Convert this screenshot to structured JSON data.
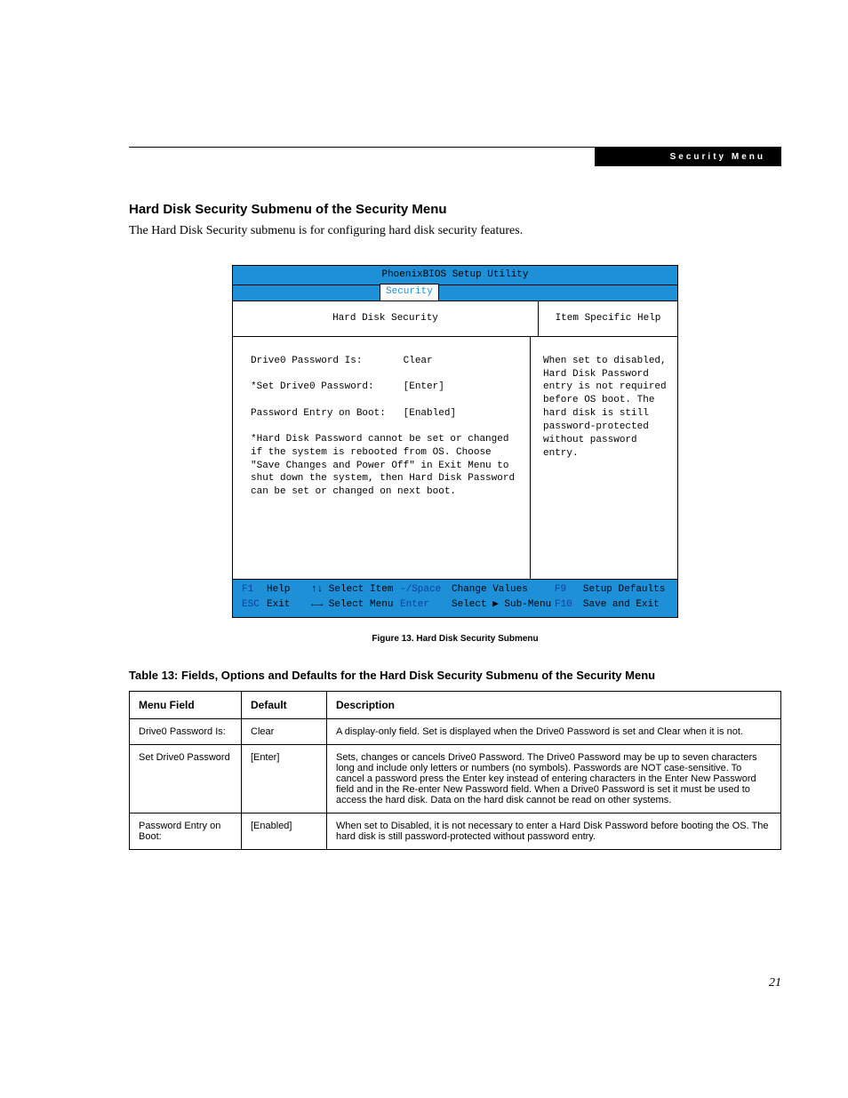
{
  "header": {
    "breadcrumb": "Security Menu"
  },
  "section": {
    "heading": "Hard Disk Security Submenu of the Security Menu",
    "sub": "The Hard Disk Security submenu is for configuring hard disk security features."
  },
  "bios": {
    "title": "PhoenixBIOS Setup Utility",
    "tab": "Security",
    "panel_heading_left": "Hard Disk Security",
    "panel_heading_right": "Item Specific Help",
    "fields": [
      {
        "label": "Drive0 Password Is:",
        "value": "Clear"
      },
      {
        "label": "*Set Drive0 Password:",
        "value": "[Enter]"
      },
      {
        "label": "Password Entry on Boot:",
        "value": "[Enabled]"
      }
    ],
    "note": "*Hard Disk Password cannot be set or changed if the system is rebooted from OS. Choose \"Save Changes and Power Off\" in Exit Menu to shut down the system, then Hard Disk Password can be set or changed on next boot.",
    "help_text": "When set to disabled, Hard Disk Password entry is not required before OS boot. The hard disk is still password-protected without password entry.",
    "footer": {
      "r1": {
        "k1": "F1",
        "l1": "Help",
        "nav1": "↑↓ Select Item",
        "k2": "-/Space",
        "l2": "Change Values",
        "k3": "F9",
        "l3": "Setup Defaults"
      },
      "r2": {
        "k1": "ESC",
        "l1": "Exit",
        "nav1": "←→ Select Menu",
        "k2": "Enter",
        "l2": "Select ▶ Sub-Menu",
        "k3": "F10",
        "l3": "Save and Exit"
      }
    }
  },
  "figure_caption": "Figure 13.   Hard Disk Security Submenu",
  "table_caption": "Table 13: Fields, Options and Defaults for the Hard Disk Security Submenu of the Security Menu",
  "table": {
    "headers": [
      "Menu Field",
      "Default",
      "Description"
    ],
    "rows": [
      {
        "field": "Drive0 Password Is:",
        "default": "Clear",
        "desc": "A display-only field. Set is displayed when the Drive0 Password is set and Clear when it is not."
      },
      {
        "field": "Set Drive0 Password",
        "default": "[Enter]",
        "desc": "Sets, changes or cancels Drive0 Password. The Drive0 Password may be up to seven characters long and include only letters or numbers (no symbols). Passwords are NOT case-sensitive. To cancel a password press the Enter key instead of entering characters in the Enter New Password field and in the Re-enter New Password field. When a Drive0 Password is set it must be used to access the hard disk. Data on the hard disk cannot be read on other systems."
      },
      {
        "field": "Password Entry on Boot:",
        "default": "[Enabled]",
        "desc": "When set to Disabled, it is not necessary to enter a Hard Disk Password before booting the OS. The hard disk is still password-protected without password entry."
      }
    ]
  },
  "page_number": "21"
}
